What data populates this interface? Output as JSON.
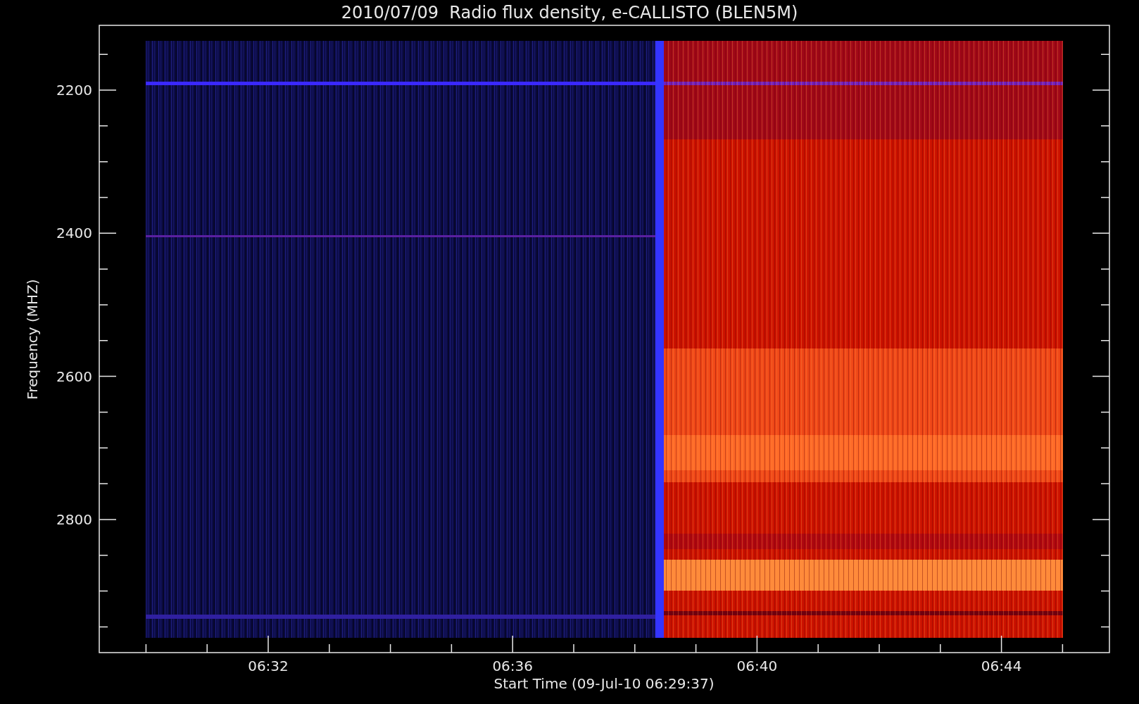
{
  "title": "2010/07/09  Radio flux density, e-CALLISTO (BLEN5M)",
  "y_axis": {
    "label": "Frequency (MHZ)",
    "ticks": [
      "2200",
      "2400",
      "2600",
      "2800"
    ]
  },
  "x_axis": {
    "label": "Start Time (09-Jul-10 06:29:37)",
    "ticks": [
      "06:32",
      "06:36",
      "06:40",
      "06:44"
    ]
  }
}
